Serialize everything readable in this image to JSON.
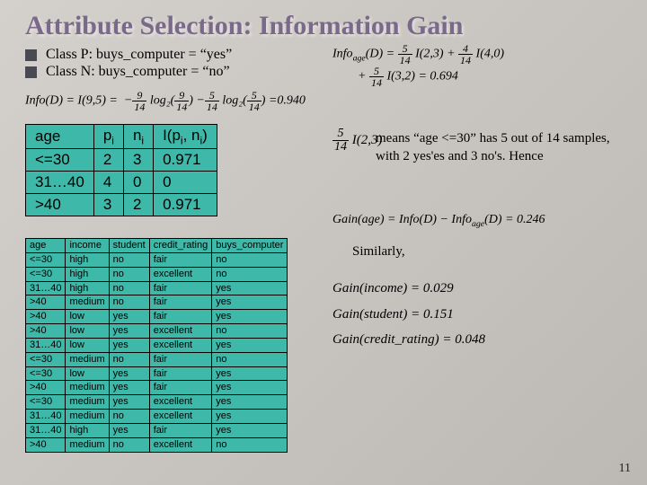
{
  "title": "Attribute Selection: Information Gain",
  "bullets": [
    "Class P: buys_computer = “yes”",
    "Class N: buys_computer = “no”"
  ],
  "info_d": {
    "lhs": "Info(D) = I(9,5) =",
    "t1_num": "9",
    "t1_den": "14",
    "log1": "log₂(",
    "t2_num": "9",
    "t2_den": "14",
    "t3_num": "5",
    "t3_den": "14",
    "log2": "log₂(",
    "t4_num": "5",
    "t4_den": "14",
    "result": "=0.940"
  },
  "age_table": {
    "headers": [
      "age",
      "p",
      "n",
      "I(p, n)"
    ],
    "sub_i": "i",
    "rows": [
      [
        "<=30",
        "2",
        "3",
        "0.971"
      ],
      [
        "31…40",
        "4",
        "0",
        "0"
      ],
      [
        ">40",
        "3",
        "2",
        "0.971"
      ]
    ]
  },
  "data_table": {
    "headers": [
      "age",
      "income",
      "student",
      "credit_rating",
      "buys_computer"
    ],
    "rows": [
      [
        "<=30",
        "high",
        "no",
        "fair",
        "no"
      ],
      [
        "<=30",
        "high",
        "no",
        "excellent",
        "no"
      ],
      [
        "31…40",
        "high",
        "no",
        "fair",
        "yes"
      ],
      [
        ">40",
        "medium",
        "no",
        "fair",
        "yes"
      ],
      [
        ">40",
        "low",
        "yes",
        "fair",
        "yes"
      ],
      [
        ">40",
        "low",
        "yes",
        "excellent",
        "no"
      ],
      [
        "31…40",
        "low",
        "yes",
        "excellent",
        "yes"
      ],
      [
        "<=30",
        "medium",
        "no",
        "fair",
        "no"
      ],
      [
        "<=30",
        "low",
        "yes",
        "fair",
        "yes"
      ],
      [
        ">40",
        "medium",
        "yes",
        "fair",
        "yes"
      ],
      [
        "<=30",
        "medium",
        "yes",
        "excellent",
        "yes"
      ],
      [
        "31…40",
        "medium",
        "no",
        "excellent",
        "yes"
      ],
      [
        "31…40",
        "high",
        "yes",
        "fair",
        "yes"
      ],
      [
        ">40",
        "medium",
        "no",
        "excellent",
        "no"
      ]
    ]
  },
  "info_age": {
    "lhs": "Info",
    "sub": "age",
    "of": "(D) =",
    "f1n": "5",
    "f1d": "14",
    "i1": "I(2,3) +",
    "f2n": "4",
    "f2d": "14",
    "i2": "I(4,0)",
    "plus": "+",
    "f3n": "5",
    "f3d": "14",
    "i3": "I(3,2) = 0.694"
  },
  "five14": {
    "num": "5",
    "den": "14",
    "of": "I(2,3)"
  },
  "means": "means “age <=30” has 5 out of 14 samples, with 2 yes'es  and 3 no's.   Hence",
  "gain_age": "Gain(age) = Info(D) − Infoₐₖₑ(D) = 0.246",
  "gain_age_parts": {
    "lhs": "Gain(age) = Info(D) − Info",
    "sub": "age",
    "rhs": "(D) = 0.246"
  },
  "similarly": "Similarly,",
  "other_gains": [
    "Gain(income) = 0.029",
    "Gain(student) = 0.151",
    "Gain(credit_rating) = 0.048"
  ],
  "page_num": "11"
}
